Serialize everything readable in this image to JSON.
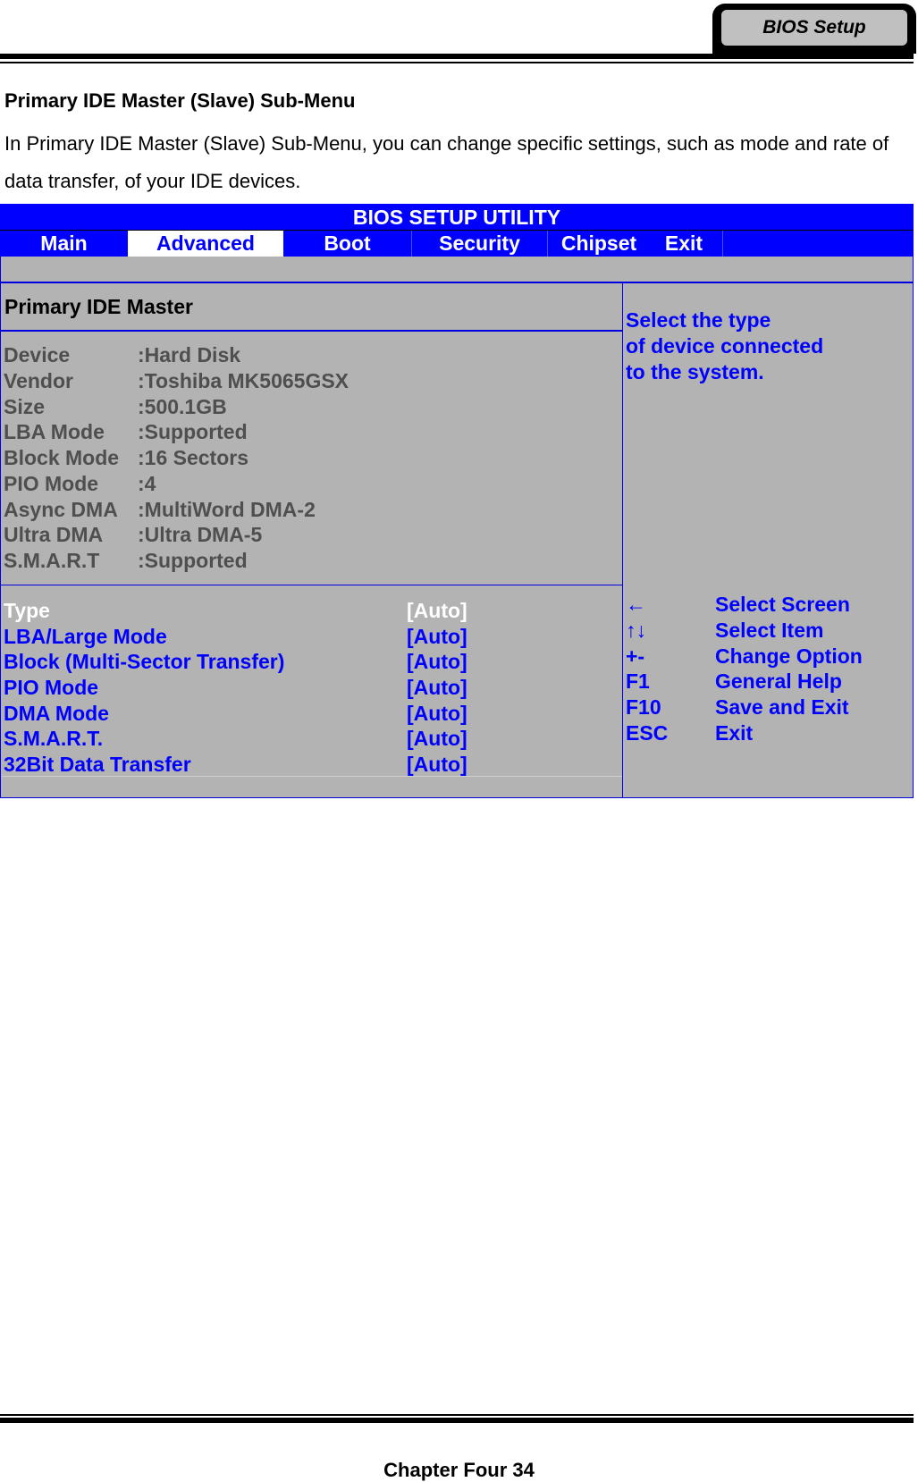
{
  "header": {
    "tab_label": "BIOS Setup"
  },
  "section": {
    "title": "Primary IDE Master (Slave) Sub-Menu",
    "intro": "In Primary IDE Master (Slave) Sub-Menu, you can change specific settings, such as mode and rate of data transfer, of your IDE devices."
  },
  "bios": {
    "title": "BIOS SETUP UTILITY",
    "tabs": [
      {
        "label": "Main",
        "active": false
      },
      {
        "label": "Advanced",
        "active": true
      },
      {
        "label": "Boot",
        "active": false
      },
      {
        "label": "Security",
        "active": false
      },
      {
        "label": "Chipset",
        "active": false
      },
      {
        "label": "Exit",
        "active": false
      }
    ],
    "pane_title": "Primary IDE Master",
    "device_info": [
      {
        "label": "Device",
        "value": ":Hard Disk"
      },
      {
        "label": "Vendor",
        "value": ":Toshiba MK5065GSX"
      },
      {
        "label": "Size",
        "value": ":500.1GB"
      },
      {
        "label": "LBA Mode",
        "value": ":Supported"
      },
      {
        "label": "Block Mode",
        "value": ":16 Sectors"
      },
      {
        "label": "PIO Mode",
        "value": ":4"
      },
      {
        "label": "Async DMA",
        "value": ":MultiWord DMA-2"
      },
      {
        "label": "Ultra DMA",
        "value": ":Ultra DMA-5"
      },
      {
        "label": "S.M.A.R.T",
        "value": ":Supported"
      }
    ],
    "settings": [
      {
        "label": "Type",
        "value": "[Auto]",
        "selected": true
      },
      {
        "label": "LBA/Large Mode",
        "value": "[Auto]",
        "selected": false
      },
      {
        "label": "Block (Multi-Sector Transfer)",
        "value": "[Auto]",
        "selected": false
      },
      {
        "label": "PIO Mode",
        "value": "[Auto]",
        "selected": false
      },
      {
        "label": "DMA Mode",
        "value": "[Auto]",
        "selected": false
      },
      {
        "label": "S.M.A.R.T.",
        "value": "[Auto]",
        "selected": false
      },
      {
        "label": "32Bit Data Transfer",
        "value": "[Auto]",
        "selected": false
      }
    ],
    "help_lines": [
      "Select the type",
      "of device connected",
      "to the system."
    ],
    "keys": [
      {
        "key": "←",
        "desc": "Select Screen",
        "icon": "left-arrow-icon"
      },
      {
        "key": "↑↓",
        "desc": "Select Item",
        "icon": "up-down-arrow-icon"
      },
      {
        "key": "+-",
        "desc": "Change Option"
      },
      {
        "key": "F1",
        "desc": "General Help"
      },
      {
        "key": "F10",
        "desc": "Save and Exit"
      },
      {
        "key": "ESC",
        "desc": "Exit"
      }
    ],
    "colors": {
      "bar": "#0000ff",
      "panel": "#b3b3b3",
      "info_text": "#4f4f4f",
      "setting_text": "#0000ff",
      "selected_text": "#ffffff"
    }
  },
  "footer": {
    "text": "Chapter Four 34"
  }
}
